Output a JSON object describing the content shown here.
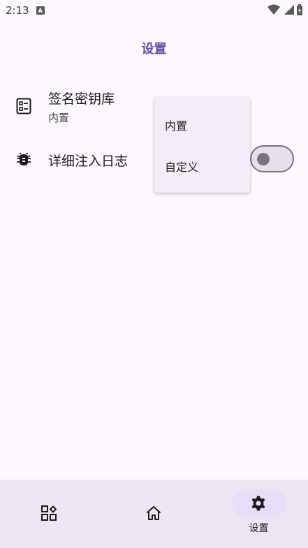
{
  "status_bar": {
    "time": "2:13",
    "a_badge": "A"
  },
  "header": {
    "title": "设置"
  },
  "settings": {
    "keystore": {
      "title": "签名密钥库",
      "value": "内置",
      "icon": "keystore-icon"
    },
    "log": {
      "title": "详细注入日志",
      "icon": "bug-icon",
      "enabled": false
    }
  },
  "dropdown": {
    "options": [
      "内置",
      "自定义"
    ]
  },
  "bottom_nav": {
    "items": [
      {
        "name": "modules",
        "icon": "grid-icon",
        "label": ""
      },
      {
        "name": "home",
        "icon": "home-icon",
        "label": ""
      },
      {
        "name": "settings",
        "icon": "gear-icon",
        "label": "设置",
        "selected": true
      }
    ]
  },
  "colors": {
    "accent": "#6750a4",
    "background": "#fdf8fd",
    "nav_background": "#ece6f0",
    "pill": "#e8def8"
  }
}
